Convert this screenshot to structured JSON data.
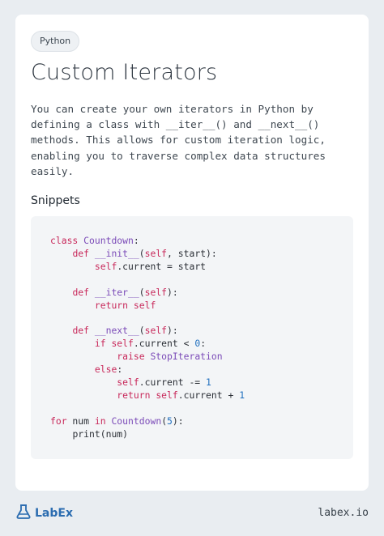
{
  "tag": "Python",
  "title": "Custom Iterators",
  "description_lines": [
    "You can create your own iterators in Python by",
    "defining a class with __iter__() and __next__()",
    "methods. This allows for custom iteration logic,",
    "enabling you to traverse complex data structures",
    "easily."
  ],
  "section_title": "Snippets",
  "code": {
    "l1_kw": "class",
    "l1_name": "Countdown",
    "l1_tail": ":",
    "l2_kw": "def",
    "l2_name": "__init__",
    "l2_self": "self",
    "l2_tail": ", start):",
    "l3_self": "self",
    "l3_tail": ".current = start",
    "l5_kw": "def",
    "l5_name": "__iter__",
    "l5_self": "self",
    "l5_tail": "):",
    "l6_kw": "return",
    "l6_self": "self",
    "l8_kw": "def",
    "l8_name": "__next__",
    "l8_self": "self",
    "l8_tail": "):",
    "l9_kw": "if",
    "l9_self": "self",
    "l9_mid": ".current < ",
    "l9_num": "0",
    "l9_tail": ":",
    "l10_kw": "raise",
    "l10_name": "StopIteration",
    "l11_kw": "else",
    "l12_self": "self",
    "l12_mid": ".current -= ",
    "l12_num": "1",
    "l13_kw": "return",
    "l13_self": "self",
    "l13_mid": ".current + ",
    "l13_num": "1",
    "l15_kw": "for",
    "l15_var": " num ",
    "l15_kw2": "in",
    "l15_name": "Countdown",
    "l15_num": "5",
    "l15_tail": "):",
    "l16_text": "print(num)"
  },
  "footer": {
    "brand": "LabEx",
    "url": "labex.io"
  },
  "colors": {
    "keyword": "#c8285a",
    "name": "#7b4bb8",
    "number": "#1f6fbf",
    "brand": "#2b6cb0"
  }
}
